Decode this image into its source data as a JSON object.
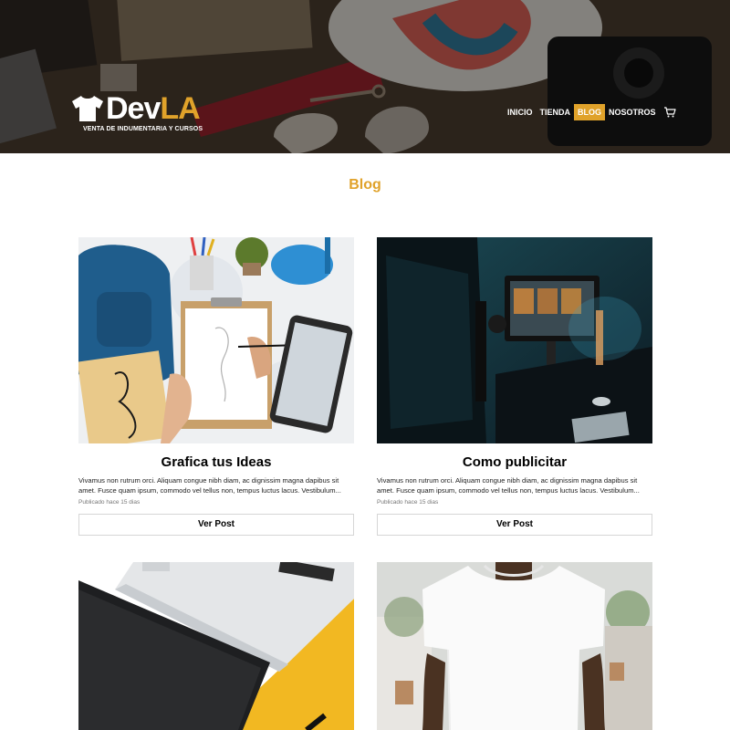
{
  "brand": {
    "name_dev": "Dev",
    "name_la": "LA",
    "tagline": "VENTA DE INDUMENTARIA Y CURSOS",
    "accent_color": "#e0a22a"
  },
  "nav": {
    "items": [
      {
        "label": "INICIO",
        "active": false
      },
      {
        "label": "TIENDA",
        "active": false
      },
      {
        "label": "BLOG",
        "active": true
      },
      {
        "label": "NOSOTROS",
        "active": false
      }
    ],
    "cart_icon": "shopping-cart-icon"
  },
  "page": {
    "title": "Blog"
  },
  "posts": [
    {
      "title": "Grafica tus Ideas",
      "excerpt": "Vivamus non rutrum orci. Aliquam congue nibh diam, ac dignissim magna dapibus sit amet. Fusce quam ipsum, commodo vel tellus non, tempus luctus lacus. Vestibulum...",
      "date": "Publicado hace 15 dias",
      "button": "Ver Post",
      "image": "drawing-desk-photo"
    },
    {
      "title": "Como publicitar",
      "excerpt": "Vivamus non rutrum orci. Aliquam congue nibh diam, ac dignissim magna dapibus sit amet. Fusce quam ipsum, commodo vel tellus non, tempus luctus lacus. Vestibulum...",
      "date": "Publicado hace 15 dias",
      "button": "Ver Post",
      "image": "monitor-editing-photo"
    },
    {
      "image": "laptop-yellow-desk-photo"
    },
    {
      "image": "white-tshirt-photo"
    }
  ]
}
